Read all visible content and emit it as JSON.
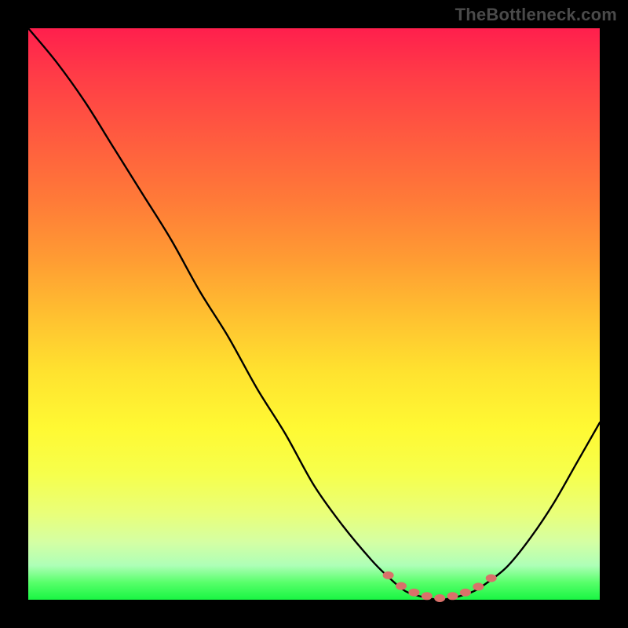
{
  "watermark": "TheBottleneck.com",
  "chart_data": {
    "type": "line",
    "title": "",
    "xlabel": "",
    "ylabel": "",
    "xlim": [
      0,
      1
    ],
    "ylim": [
      0,
      1
    ],
    "series": [
      {
        "name": "curve",
        "x": [
          0.0,
          0.05,
          0.1,
          0.15,
          0.2,
          0.25,
          0.3,
          0.35,
          0.4,
          0.45,
          0.5,
          0.55,
          0.6,
          0.63,
          0.66,
          0.69,
          0.72,
          0.75,
          0.78,
          0.81,
          0.84,
          0.88,
          0.92,
          0.96,
          1.0
        ],
        "values": [
          0.0,
          0.06,
          0.13,
          0.21,
          0.29,
          0.37,
          0.46,
          0.54,
          0.63,
          0.71,
          0.8,
          0.87,
          0.93,
          0.96,
          0.985,
          0.995,
          1.0,
          0.995,
          0.985,
          0.965,
          0.94,
          0.89,
          0.83,
          0.76,
          0.69
        ]
      }
    ],
    "gradient_stops": [
      {
        "pos": 0.0,
        "color": "#ff1f4d"
      },
      {
        "pos": 0.5,
        "color": "#ffbf30"
      },
      {
        "pos": 0.8,
        "color": "#f6ff4c"
      },
      {
        "pos": 1.0,
        "color": "#19f543"
      }
    ],
    "dots": {
      "color": "#d9716a",
      "count": 9
    }
  }
}
